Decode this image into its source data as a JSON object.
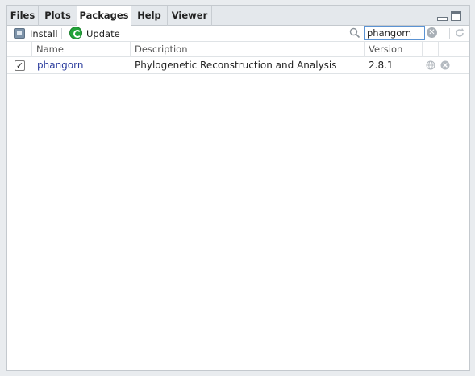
{
  "tabs": [
    {
      "label": "Files",
      "active": false
    },
    {
      "label": "Plots",
      "active": false
    },
    {
      "label": "Packages",
      "active": true
    },
    {
      "label": "Help",
      "active": false
    },
    {
      "label": "Viewer",
      "active": false
    }
  ],
  "toolbar": {
    "install_label": "Install",
    "update_label": "Update",
    "search_value": "phangorn",
    "search_placeholder": ""
  },
  "table": {
    "columns": [
      "",
      "Name",
      "Description",
      "Version",
      "",
      ""
    ],
    "rows": [
      {
        "checked": true,
        "name": "phangorn",
        "description": "Phylogenetic Reconstruction and Analysis",
        "version": "2.8.1"
      }
    ]
  },
  "colors": {
    "accent": "#5b93d3",
    "link": "#2a3b9c",
    "update_green": "#23a33a"
  }
}
